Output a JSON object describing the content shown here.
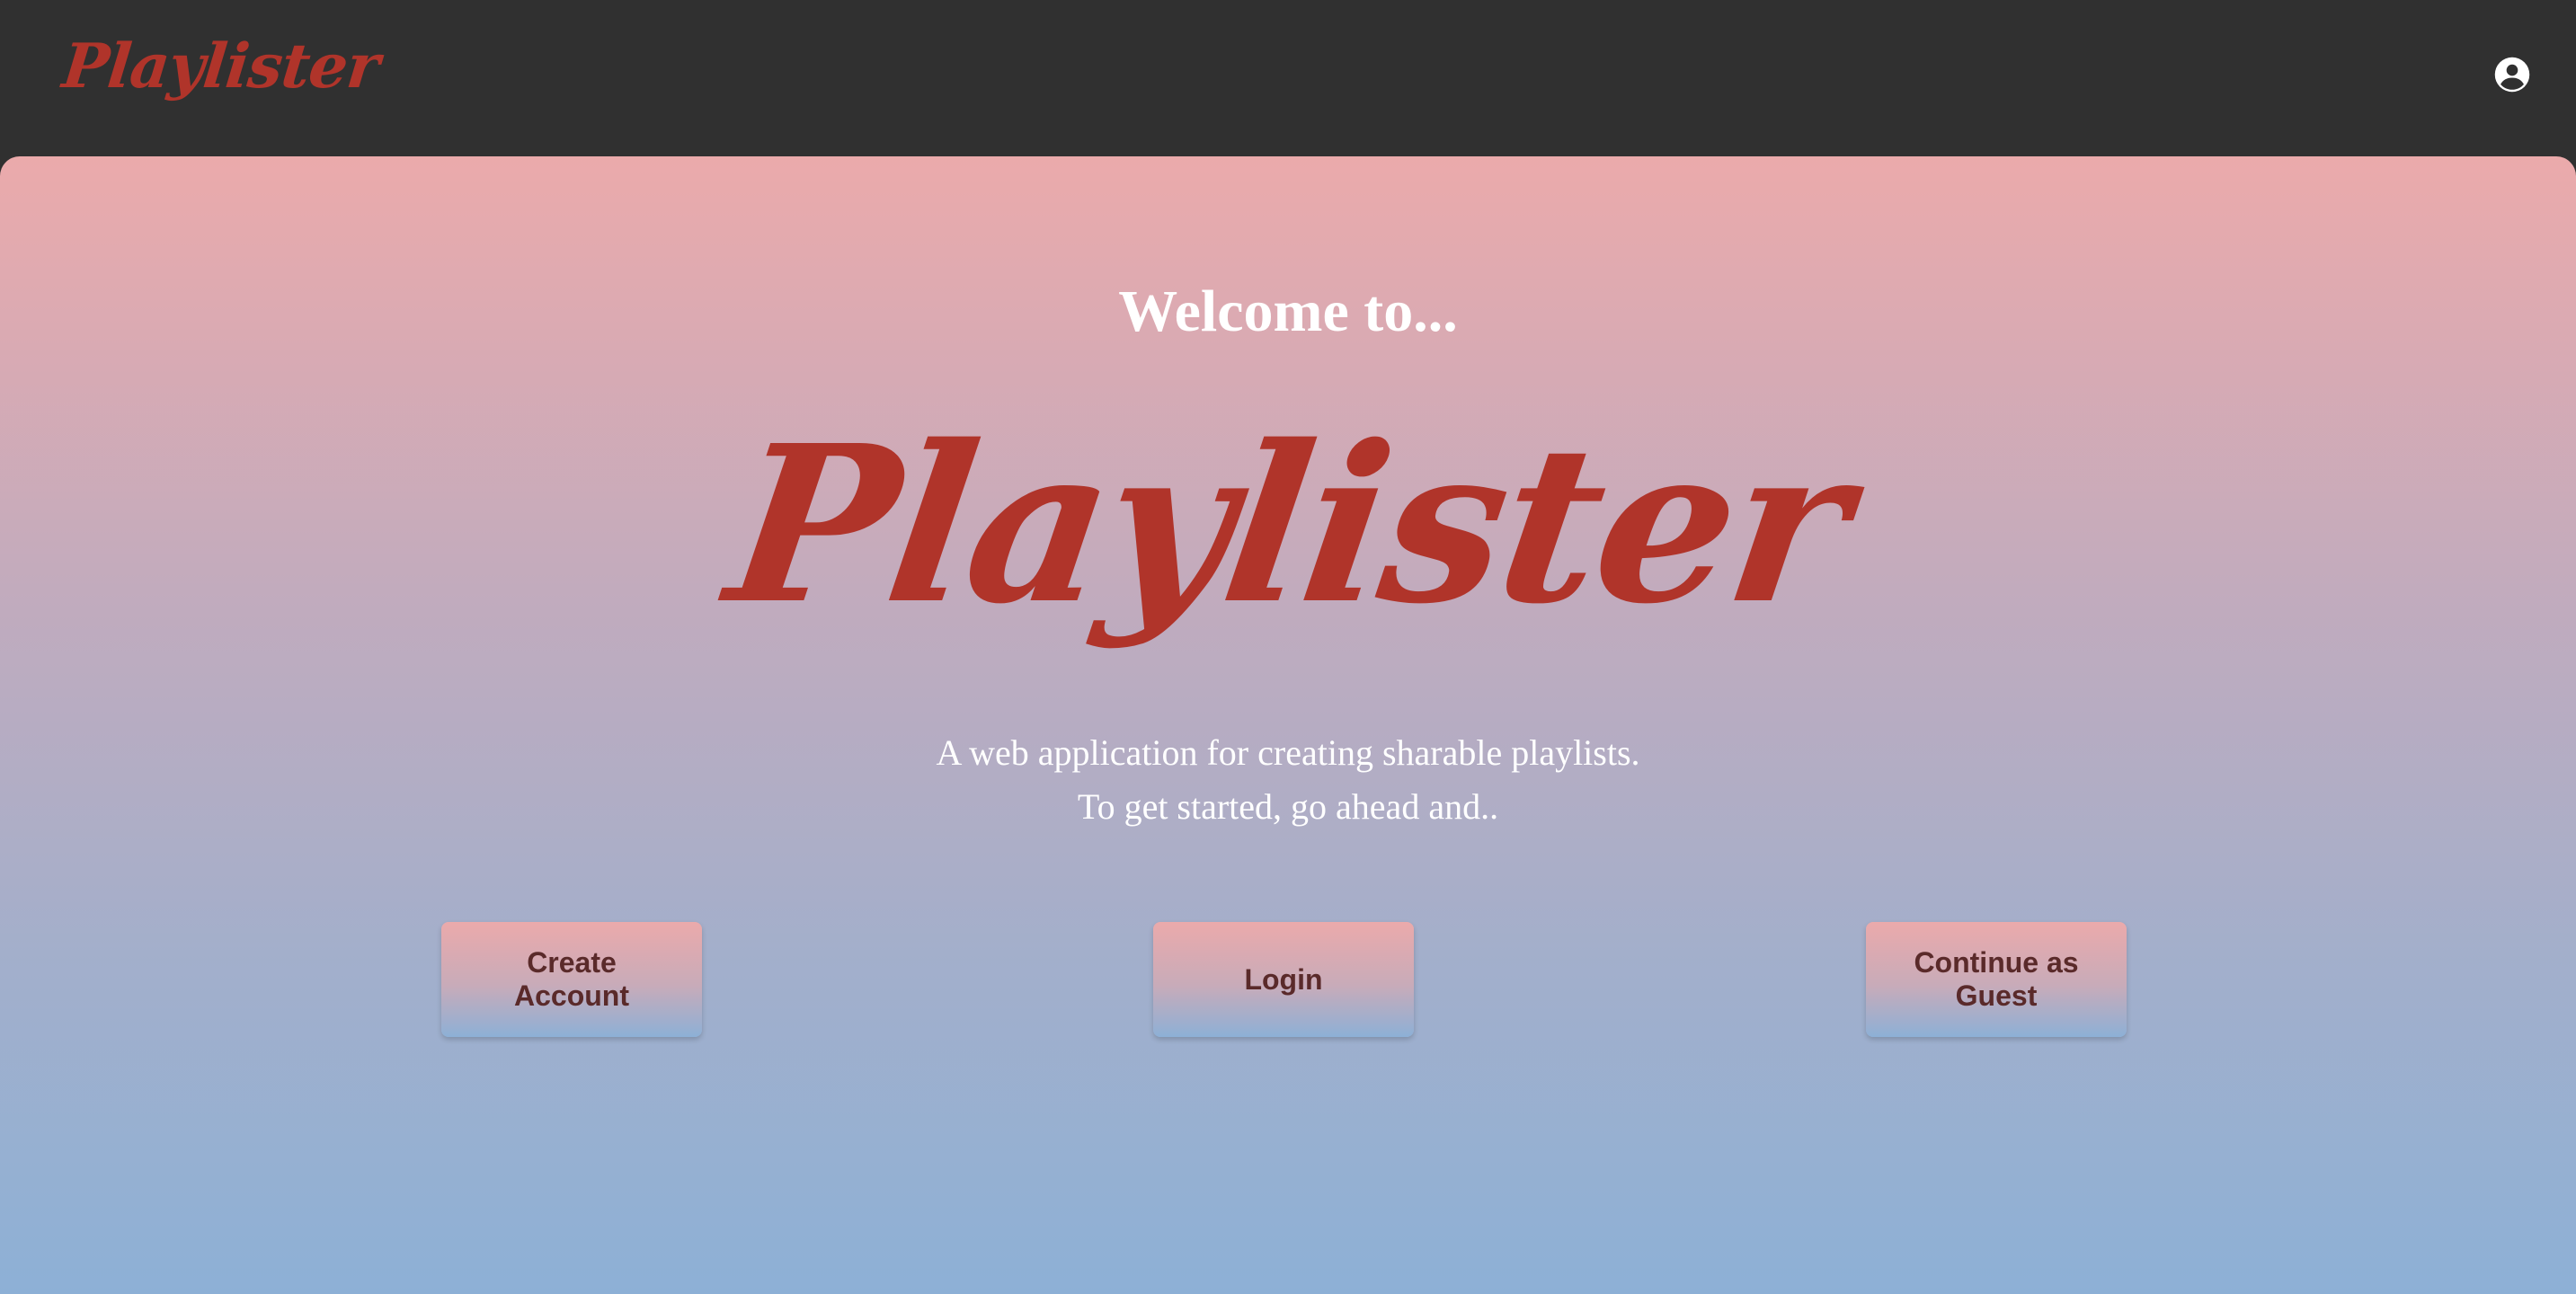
{
  "topbar": {
    "logo_text": "Playlister",
    "account_icon": "account-circle-icon"
  },
  "splash": {
    "welcome": "Welcome to...",
    "logo_text": "Playlister",
    "tagline_line1": "A web application for creating sharable playlists.",
    "tagline_line2": "To get started, go ahead and..",
    "buttons": {
      "create_account": "Create Account",
      "login": "Login",
      "guest": "Continue as Guest"
    }
  },
  "colors": {
    "topbar_bg": "#303030",
    "logo_red": "#b0342a",
    "gradient_top": "#ebaaab",
    "gradient_bottom": "#8db0d6",
    "button_text": "#5a2a2a"
  }
}
